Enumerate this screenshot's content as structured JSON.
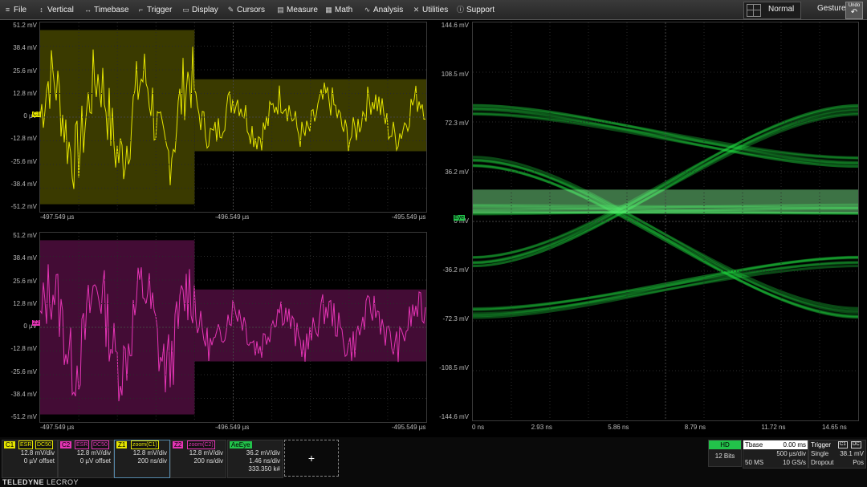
{
  "menu": {
    "file": "File",
    "vertical": "Vertical",
    "timebase": "Timebase",
    "trigger": "Trigger",
    "display": "Display",
    "cursors": "Cursors",
    "measure": "Measure",
    "math": "Math",
    "analysis": "Analysis",
    "utilities": "Utilities",
    "support": "Support"
  },
  "mode": "Normal",
  "gesture": "Gesture",
  "undo_label": "Undo",
  "colors": {
    "c1": "#e5e500",
    "c2": "#e535b5",
    "eye": "#22dd44",
    "grid": "#333333"
  },
  "grid1": {
    "ylabels": [
      "51.2 mV",
      "38.4 mV",
      "25.6 mV",
      "12.8 mV",
      "0 µV",
      "-12.8 mV",
      "-25.6 mV",
      "-38.4 mV",
      "-51.2 mV"
    ],
    "xlabels": [
      "-497.549 µs",
      "-496.549 µs",
      "-495.549 µs"
    ],
    "marker": "C1"
  },
  "grid2": {
    "ylabels": [
      "51.2 mV",
      "38.4 mV",
      "25.6 mV",
      "12.8 mV",
      "0 µV",
      "-12.8 mV",
      "-25.6 mV",
      "-38.4 mV",
      "-51.2 mV"
    ],
    "xlabels": [
      "-497.549 µs",
      "-496.549 µs",
      "-495.549 µs"
    ],
    "marker": "Z2"
  },
  "grid3": {
    "ylabels": [
      "144.6 mV",
      "108.5 mV",
      "72.3 mV",
      "36.2 mV",
      "0 mV",
      "-36.2 mV",
      "-72.3 mV",
      "-108.5 mV",
      "-144.6 mV"
    ],
    "xlabels": [
      "0 ns",
      "2.93 ns",
      "5.86 ns",
      "8.79 ns",
      "11.72 ns",
      "14.65 ns"
    ],
    "marker": "Eye"
  },
  "descriptors": [
    {
      "id": "C1",
      "tags": [
        "ESR",
        "DC50"
      ],
      "color": "#e5e500",
      "r1": "12.8 mV/div",
      "r2": "0 µV offset",
      "r3": ""
    },
    {
      "id": "C2",
      "tags": [
        "ESR",
        "DC50"
      ],
      "color": "#e535b5",
      "r1": "12.8 mV/div",
      "r2": "0 µV offset",
      "r3": ""
    },
    {
      "id": "Z1",
      "tags": [
        "zoom(C1)"
      ],
      "color": "#e5e500",
      "r1": "12.8 mV/div",
      "r2": "200 ns/div",
      "r3": ""
    },
    {
      "id": "Z2",
      "tags": [
        "zoom(C2)"
      ],
      "color": "#e535b5",
      "r1": "12.8 mV/div",
      "r2": "200 ns/div",
      "r3": ""
    },
    {
      "id": "AeEye",
      "tags": [],
      "color": "#22c24a",
      "r1": "36.2 mV/div",
      "r2": "1.46 ns/div",
      "r3": "333.350 k#"
    }
  ],
  "add_label": "+",
  "hd": {
    "title": "HD",
    "bits": "12 Bits"
  },
  "timebase": {
    "title": "Tbase",
    "delay": "0.00 ms",
    "per_div": "500 µs/div",
    "ms": "50 MS",
    "rate": "10 GS/s"
  },
  "trigger": {
    "title": "Trigger",
    "src1": "C1",
    "src2": "DC",
    "mode": "Single",
    "level": "38.1 mV",
    "type": "Dropout",
    "slope": "Pos"
  },
  "brand": {
    "a": "TELEDYNE",
    "b": "LECROY"
  }
}
